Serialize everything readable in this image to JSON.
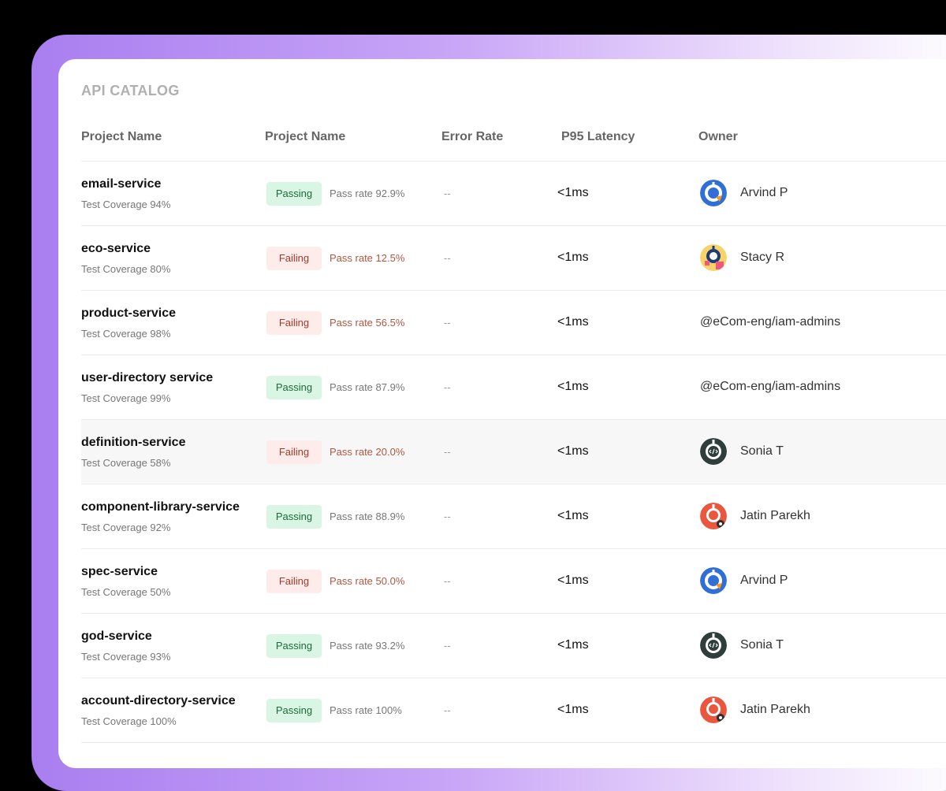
{
  "title": "API CATALOG",
  "columns": [
    "Project Name",
    "Project Name",
    "Error Rate",
    "P95 Latency",
    "Owner"
  ],
  "colors": {
    "passing_bg": "#d9f5e3",
    "failing_bg": "#fdece9",
    "frame_accent": "#a97ef0"
  },
  "rows": [
    {
      "name": "email-service",
      "coverage": "Test Coverage 94%",
      "status": "Passing",
      "pass_rate": "Pass rate 92.9%",
      "error_rate": "--",
      "latency": "<1ms",
      "owner": "Arvind P",
      "avatar": "blue-robot-avatar-icon"
    },
    {
      "name": "eco-service",
      "coverage": "Test Coverage 80%",
      "status": "Failing",
      "pass_rate": "Pass rate 12.5%",
      "error_rate": "--",
      "latency": "<1ms",
      "owner": "Stacy R",
      "avatar": "yellow-robot-avatar-icon"
    },
    {
      "name": "product-service",
      "coverage": "Test Coverage 98%",
      "status": "Failing",
      "pass_rate": "Pass rate 56.5%",
      "error_rate": "--",
      "latency": "<1ms",
      "owner": "@eCom-eng/iam-admins",
      "avatar": ""
    },
    {
      "name": "user-directory service",
      "coverage": "Test Coverage 99%",
      "status": "Passing",
      "pass_rate": "Pass rate 87.9%",
      "error_rate": "--",
      "latency": "<1ms",
      "owner": "@eCom-eng/iam-admins",
      "avatar": ""
    },
    {
      "name": "definition-service",
      "coverage": "Test Coverage 58%",
      "status": "Failing",
      "pass_rate": "Pass rate 20.0%",
      "error_rate": "--",
      "latency": "<1ms",
      "owner": "Sonia T",
      "avatar": "dark-code-robot-avatar-icon"
    },
    {
      "name": "component-library-service",
      "coverage": "Test Coverage 92%",
      "status": "Passing",
      "pass_rate": "Pass rate 88.9%",
      "error_rate": "--",
      "latency": "<1ms",
      "owner": "Jatin Parekh",
      "avatar": "orange-robot-avatar-icon"
    },
    {
      "name": "spec-service",
      "coverage": "Test Coverage 50%",
      "status": "Failing",
      "pass_rate": "Pass rate 50.0%",
      "error_rate": "--",
      "latency": "<1ms",
      "owner": "Arvind P",
      "avatar": "blue-robot-avatar-icon"
    },
    {
      "name": "god-service",
      "coverage": "Test Coverage 93%",
      "status": "Passing",
      "pass_rate": "Pass rate 93.2%",
      "error_rate": "--",
      "latency": "<1ms",
      "owner": "Sonia T",
      "avatar": "dark-code-robot-avatar-icon"
    },
    {
      "name": "account-directory-service",
      "coverage": "Test Coverage 100%",
      "status": "Passing",
      "pass_rate": "Pass rate 100%",
      "error_rate": "--",
      "latency": "<1ms",
      "owner": "Jatin Parekh",
      "avatar": "orange-robot-avatar-icon"
    }
  ]
}
